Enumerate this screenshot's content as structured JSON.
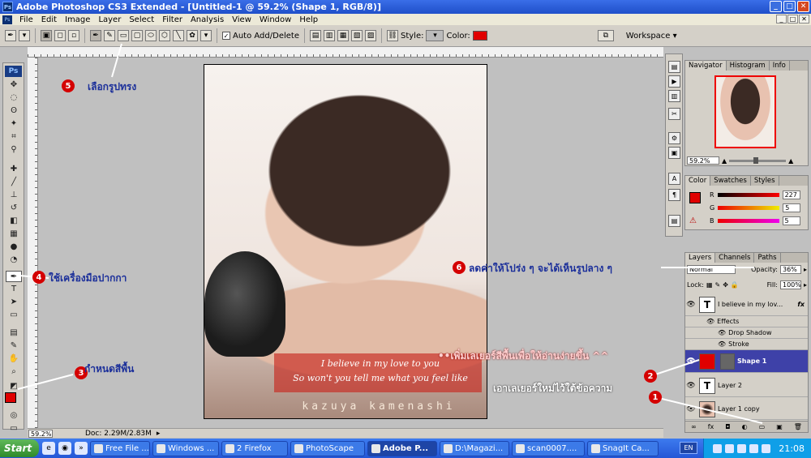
{
  "window": {
    "title": "Adobe Photoshop CS3 Extended - [Untitled-1 @ 59.2% (Shape 1, RGB/8)]",
    "app_badge": "Ps",
    "min": "_",
    "max": "□",
    "close": "✕",
    "doc_min": "_",
    "doc_max": "□",
    "doc_close": "✕"
  },
  "menu": [
    "File",
    "Edit",
    "Image",
    "Layer",
    "Select",
    "Filter",
    "Analysis",
    "View",
    "Window",
    "Help"
  ],
  "options": {
    "auto_add_delete": "Auto Add/Delete",
    "style_label": "Style:",
    "color_label": "Color:",
    "workspace": "Workspace ▾",
    "color_hex": "#e00000"
  },
  "tools": {
    "logo": "Ps"
  },
  "document": {
    "lyrics1": "I believe in my love to you",
    "lyrics2": "So won't you tell me what you feel like",
    "signature": "kazuya kamenashi"
  },
  "status": {
    "zoom": "59.2%",
    "doc": "Doc: 2.29M/2.83M"
  },
  "navigator": {
    "tabs": [
      "Navigator",
      "Histogram",
      "Info"
    ],
    "zoom": "59.2%"
  },
  "color_panel": {
    "tabs": [
      "Color",
      "Swatches",
      "Styles"
    ],
    "r_label": "R",
    "g_label": "G",
    "b_label": "B",
    "r": "227",
    "g": "5",
    "b": "5"
  },
  "layers_panel": {
    "tabs": [
      "Layers",
      "Channels",
      "Paths"
    ],
    "blend": "Normal",
    "opacity_label": "Opacity:",
    "opacity": "36%",
    "lock_label": "Lock:",
    "fill_label": "Fill:",
    "fill": "100%",
    "layers": [
      {
        "name": "I believe in my lov...",
        "thumb": "T",
        "fx": "fx"
      },
      {
        "name": "Effects"
      },
      {
        "name": "Drop Shadow"
      },
      {
        "name": "Stroke"
      },
      {
        "name": "Shape 1"
      },
      {
        "name": "Layer 2",
        "thumb": "T"
      },
      {
        "name": "Layer 1 copy"
      }
    ],
    "footer": [
      "∞",
      "fx",
      "◘",
      "◐",
      "▭",
      "▣",
      "🗑"
    ]
  },
  "annotations": {
    "n1": "1",
    "n2": "2",
    "n3": "3",
    "n4": "4",
    "n5": "5",
    "n6": "6",
    "t2": "เอาเลเยอร์ใหม่ไว้ใต้ข้อความ",
    "t3": "กำหนดสีพื้น",
    "t4": "ใช้เครื่องมือปากกา",
    "t5": "เลือกรูปทรง",
    "t6": "ลดค่าให้โปร่ง ๆ จะได้เห็นรูปลาง ๆ",
    "t7": "••เพิ่มเลเยอร์สีพื้นเพื่อให้อ่านง่ายขึ้น ^^"
  },
  "taskbar": {
    "start": "Start",
    "tasks": [
      "Free File ...",
      "Windows ...",
      "2 Firefox",
      "PhotoScape",
      "Adobe P...",
      "D:\\Magazi...",
      "scan0007....",
      "SnagIt Ca..."
    ],
    "lang": "EN",
    "time": "21:08"
  }
}
